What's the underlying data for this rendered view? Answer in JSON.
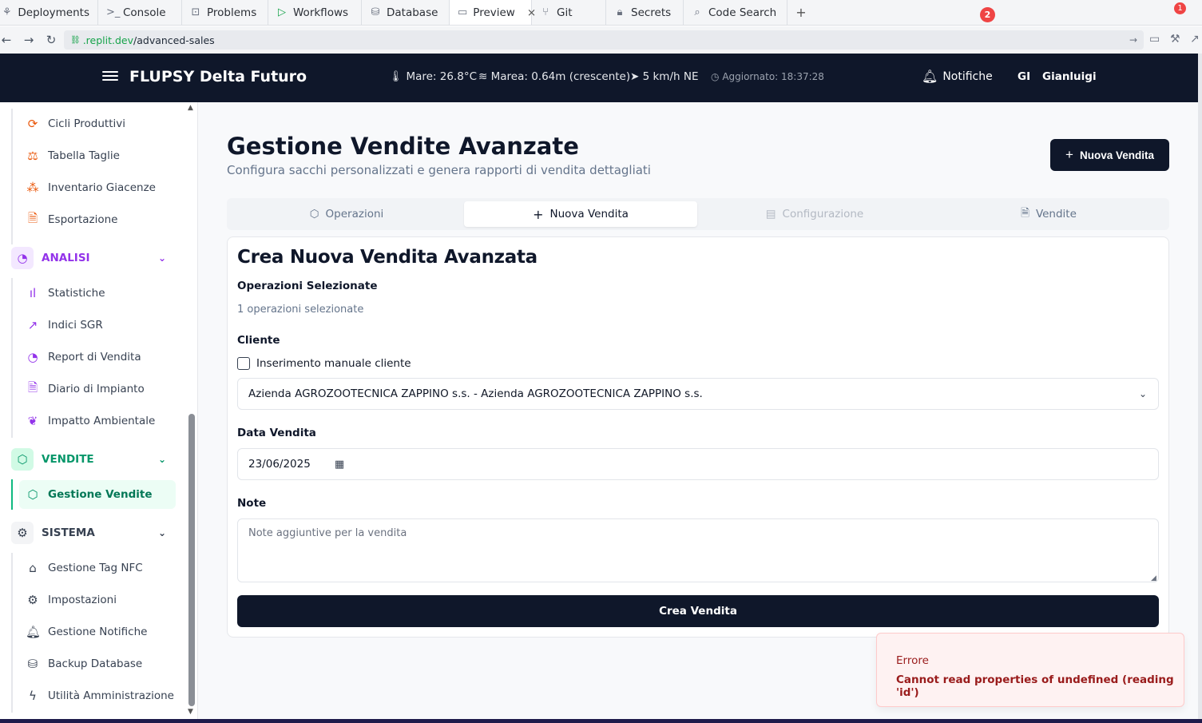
{
  "ide_tabs": [
    {
      "label": "Deployments",
      "icon": "deployments-icon"
    },
    {
      "label": "Console",
      "icon": "console-icon"
    },
    {
      "label": "Problems",
      "icon": "problems-icon"
    },
    {
      "label": "Workflows",
      "icon": "play-icon"
    },
    {
      "label": "Database",
      "icon": "database-icon"
    },
    {
      "label": "Preview",
      "icon": "monitor-icon",
      "active": true
    },
    {
      "label": "Git",
      "icon": "git-icon"
    },
    {
      "label": "Secrets",
      "icon": "lock-icon"
    },
    {
      "label": "Code Search",
      "icon": "search-icon"
    }
  ],
  "address": {
    "domain": ".replit.dev",
    "path": "/advanced-sales",
    "notif_count": "1"
  },
  "header": {
    "title": "FLUPSY Delta Futuro",
    "sea_temp": "Mare: 26.8°C",
    "tide": "Marea: 0.64m (crescente)",
    "wind": "5 km/h NE",
    "updated": "Aggiornato: 18:37:28",
    "notifications_label": "Notifiche",
    "notifications_count": "2",
    "user_initials": "GI",
    "user_name": "Gianluigi"
  },
  "sidebar": {
    "top_items": [
      {
        "label": "Cicli Produttivi",
        "icon": "refresh-icon"
      },
      {
        "label": "Tabella Taglie",
        "icon": "scale-icon"
      },
      {
        "label": "Inventario Giacenze",
        "icon": "boxes-icon"
      },
      {
        "label": "Esportazione",
        "icon": "file-code-icon"
      }
    ],
    "analisi": {
      "label": "ANALISI",
      "items": [
        {
          "label": "Statistiche",
          "icon": "bar-chart-icon"
        },
        {
          "label": "Indici SGR",
          "icon": "trending-up-icon"
        },
        {
          "label": "Report di Vendita",
          "icon": "pie-chart-icon"
        },
        {
          "label": "Diario di Impianto",
          "icon": "file-text-icon"
        },
        {
          "label": "Impatto Ambientale",
          "icon": "leaf-icon"
        }
      ]
    },
    "vendite": {
      "label": "VENDITE",
      "items": [
        {
          "label": "Gestione Vendite",
          "icon": "package-icon",
          "active": true
        }
      ]
    },
    "sistema": {
      "label": "SISTEMA",
      "items": [
        {
          "label": "Gestione Tag NFC",
          "icon": "tag-icon"
        },
        {
          "label": "Impostazioni",
          "icon": "settings-icon"
        },
        {
          "label": "Gestione Notifiche",
          "icon": "bell-icon"
        },
        {
          "label": "Backup Database",
          "icon": "database-icon"
        },
        {
          "label": "Utilità Amministrazione",
          "icon": "zap-icon"
        }
      ]
    }
  },
  "page": {
    "title": "Gestione Vendite Avanzate",
    "subtitle": "Configura sacchi personalizzati e genera rapporti di vendita dettagliati",
    "new_sale_button": "Nuova Vendita"
  },
  "tabs": [
    {
      "label": "Operazioni",
      "icon": "package-icon"
    },
    {
      "label": "Nuova Vendita",
      "icon": "plus-icon",
      "active": true
    },
    {
      "label": "Configurazione",
      "icon": "calculator-icon",
      "disabled": true
    },
    {
      "label": "Vendite",
      "icon": "file-text-icon"
    }
  ],
  "form": {
    "title": "Crea Nuova Vendita Avanzata",
    "ops_label": "Operazioni Selezionate",
    "ops_value": "1 operazioni selezionate",
    "client_label": "Cliente",
    "manual_client_label": "Inserimento manuale cliente",
    "manual_client_checked": false,
    "client_selected": "Azienda AGROZOOTECNICA ZAPPINO s.s. - Azienda AGROZOOTECNICA ZAPPINO s.s.",
    "date_label": "Data Vendita",
    "date_value": "23/06/2025",
    "notes_label": "Note",
    "notes_placeholder": "Note aggiuntive per la vendita",
    "submit_label": "Crea Vendita"
  },
  "toast": {
    "title": "Errore",
    "message": "Cannot read properties of undefined (reading 'id')"
  },
  "colors": {
    "header_bg": "#0f172a",
    "accent_green": "#059669",
    "analisi_purple": "#9333ea",
    "error_red": "#991b1b"
  }
}
